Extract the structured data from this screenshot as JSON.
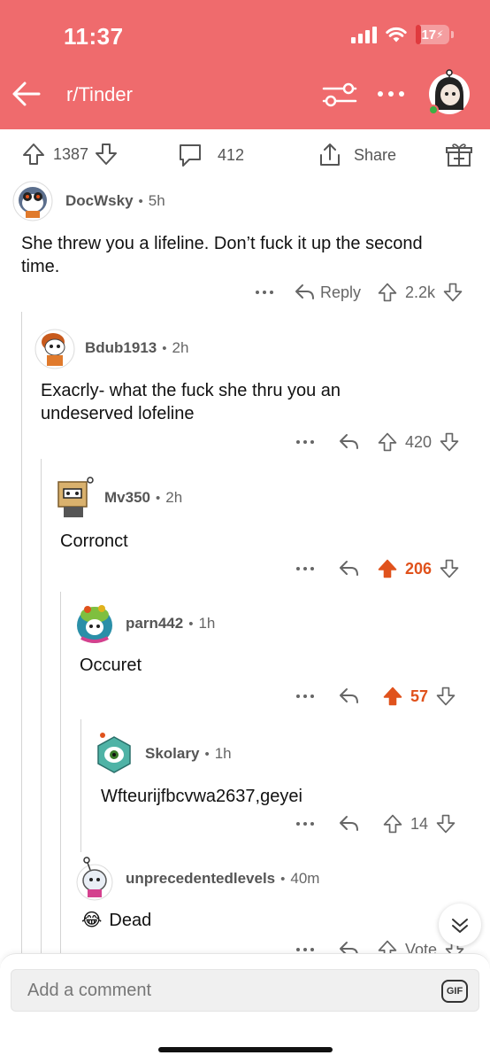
{
  "status_bar": {
    "time": "11:37",
    "battery": "17",
    "battery_level": 0.17
  },
  "header": {
    "subreddit": "r/Tinder"
  },
  "post_actions": {
    "upvotes": "1387",
    "comments": "412",
    "share_label": "Share"
  },
  "comments": [
    {
      "author": "DocWsky",
      "time": "5h",
      "body_lines": [
        "She threw you a lifeline. Don’t fuck it up the second",
        "time."
      ],
      "reply_label": "Reply",
      "score": "2.2k",
      "upvoted": false
    },
    {
      "author": "Bdub1913",
      "time": "2h",
      "body_lines": [
        "Exacrly- what the fuck she thru you an",
        "undeserved lofeline"
      ],
      "score": "420",
      "upvoted": false
    },
    {
      "author": "Mv350",
      "time": "2h",
      "body_lines": [
        "Corronct"
      ],
      "score": "206",
      "upvoted": true
    },
    {
      "author": "parn442",
      "time": "1h",
      "body_lines": [
        "Occuret"
      ],
      "score": "57",
      "upvoted": true
    },
    {
      "author": "Skolary",
      "time": "1h",
      "body_lines": [
        "Wfteurijfbcvwa2637,geyei"
      ],
      "score": "14",
      "upvoted": false
    },
    {
      "author": "unprecedentedlevels",
      "time": "40m",
      "body_lines": [
        "Dead"
      ],
      "emoji": "😂",
      "score": "Vote",
      "upvoted": false
    }
  ],
  "composer": {
    "placeholder": "Add a comment",
    "gif_label": "GIF"
  },
  "colors": {
    "header_bg": "#ef6b6d",
    "upvote_active": "#e0521c",
    "online": "#3cb043"
  },
  "icons": [
    "back-arrow-icon",
    "filter-icon",
    "more-icon",
    "upvote-icon",
    "downvote-icon",
    "comment-icon",
    "share-icon",
    "gift-icon",
    "reply-icon",
    "chevron-down-icon"
  ]
}
